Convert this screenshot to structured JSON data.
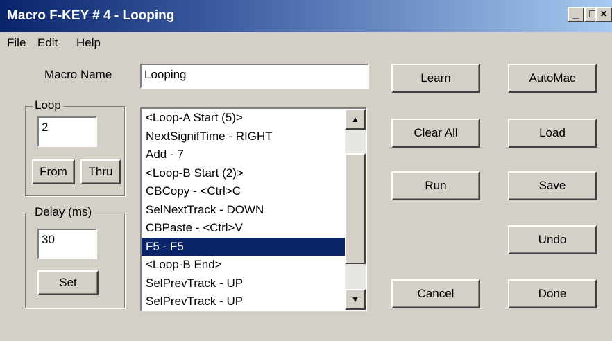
{
  "window": {
    "title": "Macro F-KEY # 4 - Looping",
    "minimize_glyph": "_",
    "maximize_glyph": "□",
    "close_glyph": "×"
  },
  "menu": {
    "items": [
      "File",
      "Edit",
      "Help"
    ]
  },
  "macro_name": {
    "label": "Macro Name",
    "value": "Looping"
  },
  "loop_group": {
    "label": "Loop",
    "value": "2",
    "from_label": "From",
    "thru_label": "Thru"
  },
  "delay_group": {
    "label": "Delay (ms)",
    "value": "30",
    "set_label": "Set"
  },
  "list": {
    "items": [
      "<Loop-A Start (5)>",
      "NextSignifTime - RIGHT",
      "Add - 7",
      "<Loop-B Start (2)>",
      "CBCopy - <Ctrl>C",
      "SelNextTrack - DOWN",
      "CBPaste - <Ctrl>V",
      "F5 - F5",
      "<Loop-B End>",
      "SelPrevTrack - UP",
      "SelPrevTrack - UP"
    ],
    "selected_index": 7,
    "scroll_up_icon": "▲",
    "scroll_down_icon": "▼"
  },
  "buttons": {
    "learn": "Learn",
    "clear_all": "Clear All",
    "run": "Run",
    "cancel": "Cancel",
    "automac": "AutoMac",
    "load": "Load",
    "save": "Save",
    "undo": "Undo",
    "done": "Done"
  },
  "colors": {
    "title_start": "#0a246a",
    "title_end": "#a6caf0",
    "selection": "#0a246a",
    "face": "#d4d0c8"
  }
}
